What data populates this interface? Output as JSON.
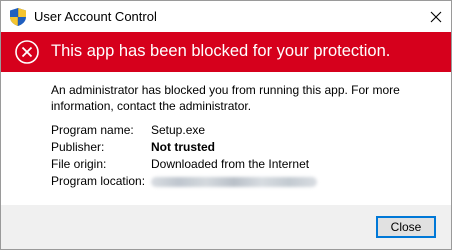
{
  "window": {
    "title": "User Account Control",
    "icon": "uac-shield-icon",
    "close_icon": "close-icon"
  },
  "banner": {
    "icon": "blocked-x-icon",
    "text": "This app has been blocked for your protection.",
    "color": "#d6001c"
  },
  "message": "An administrator has blocked you from running this app. For more information, contact the administrator.",
  "details": {
    "program_name_label": "Program name:",
    "program_name_value": "Setup.exe",
    "publisher_label": "Publisher:",
    "publisher_value": "Not trusted",
    "file_origin_label": "File origin:",
    "file_origin_value": "Downloaded from the Internet",
    "program_location_label": "Program location:"
  },
  "footer": {
    "close_label": "Close",
    "accent": "#0078d7"
  }
}
